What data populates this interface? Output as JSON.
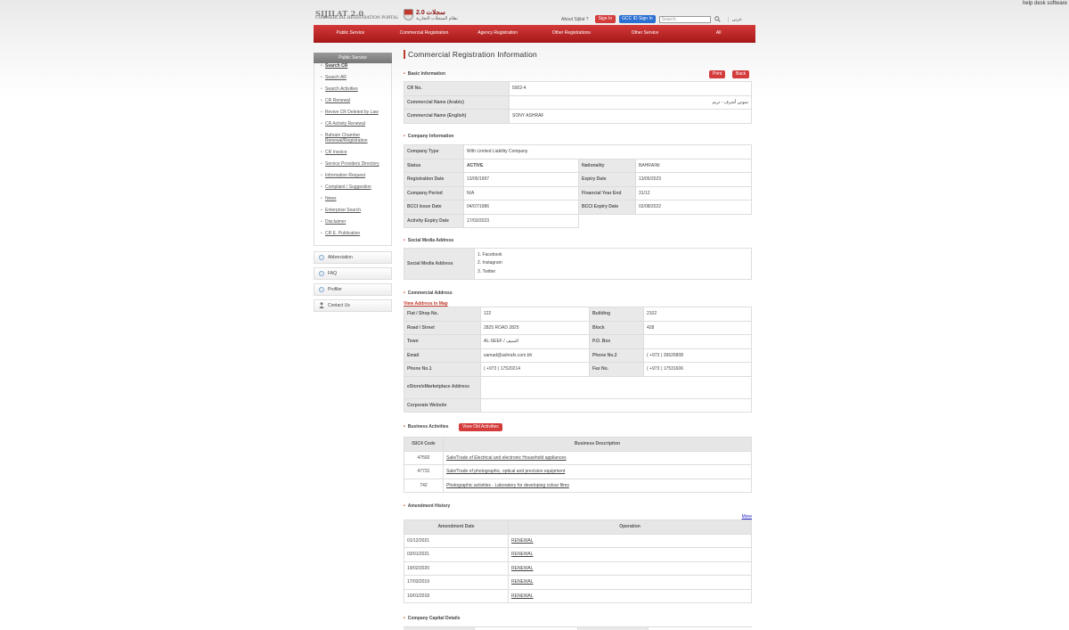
{
  "top_note": "help desk software",
  "header": {
    "logo_en": "SIJILAT 2.0",
    "logo_en_sub": "COMMERCIAL REGISTRATION PORTAL",
    "logo_ar": "سجلات 2.0",
    "logo_ar_sub": "نظام السجلات التجارية",
    "about": "About Sijilat ?",
    "sign_in": "Sign In",
    "gcc_sign_in": "GCC ID Sign In",
    "search_placeholder": "Search..",
    "lang": "عربي"
  },
  "nav": [
    "Public Service",
    "Commercial Registration",
    "Agency Registration",
    "Other Registrations",
    "Other Service",
    "All"
  ],
  "sidebar": {
    "title": "Public Service",
    "items": [
      "Search CR",
      "Search AR",
      "Search Activities",
      "CR Renewal",
      "Revive CR Deleted by Law",
      "CR Activity Renewal",
      "Bahrain Chamber Renewal/Registration",
      "CR Invoice",
      "Service Providers Directory",
      "Information Request",
      "Complaint / Suggestion",
      "News",
      "Enterprise Search",
      "Disclaimer",
      "CR E. Publication"
    ],
    "boxes": [
      {
        "label": "Abbreviation",
        "icon": "info-icon"
      },
      {
        "label": "FAQ",
        "icon": "info-icon"
      },
      {
        "label": "Profiler",
        "icon": "info-icon"
      },
      {
        "label": "Contact Us",
        "icon": "person-icon"
      }
    ]
  },
  "page_title": "Commercial Registration Information",
  "buttons": {
    "print": "Print",
    "back": "Back"
  },
  "basic": {
    "title": "Basic Information",
    "rows": [
      {
        "label": "CR No.",
        "value": "5002-4"
      },
      {
        "label": "Commercial Name (Arabic)",
        "value": "سوني أشرف - تريم"
      },
      {
        "label": "Commercial Name (English)",
        "value": "SONY ASHRAF"
      }
    ]
  },
  "company": {
    "title": "Company Information",
    "company_type_label": "Company Type",
    "company_type": "With Limited Liability Company",
    "status_label": "Status",
    "status": "ACTIVE",
    "nationality_label": "Nationality",
    "nationality": "BAHRAINI",
    "reg_date_label": "Registration Date",
    "reg_date": "13/05/1997",
    "expiry_label": "Expiry Date",
    "expiry": "13/05/2023",
    "period_label": "Company Period",
    "period": "N/A",
    "fy_label": "Financial Year End",
    "fy": "31/12",
    "bcci_issue_label": "BCCI Issue Date",
    "bcci_issue": "04/07/1986",
    "bcci_expiry_label": "BCCI Expiry Date",
    "bcci_expiry": "02/08/2022",
    "activity_expiry_label": "Activity Expiry Date",
    "activity_expiry": "17/03/2023"
  },
  "social": {
    "title": "Social Media Address",
    "label": "Social Media Address",
    "items": [
      "1. Facebook",
      "2. Instagram",
      "3. Twitter"
    ]
  },
  "address": {
    "title": "Commercial Address",
    "map_link": "View Address in Map",
    "flat_label": "Flat / Shop No.",
    "flat": "122",
    "building_label": "Building",
    "building": "2102",
    "road_label": "Road / Street",
    "road": "2825 ROAD 2825",
    "block_label": "Block",
    "block": "428",
    "town_label": "Town",
    "town": "AL-SEEF / السيف",
    "pobox_label": "P.O. Box",
    "pobox": "",
    "email_label": "Email",
    "email": "samad@ashrafs.com.bh",
    "phone2_label": "Phone No.2",
    "phone2": "( +973 ) 39626808",
    "phone1_label": "Phone No.1",
    "phone1": "( +973 ) 17520214",
    "fax_label": "Fax No.",
    "fax": "( +973 ) 17531606",
    "estore_label": "eStore/eMarketplace Address",
    "estore": "",
    "website_label": "Corporate Website",
    "website": ""
  },
  "activities": {
    "title": "Business Activities",
    "old_button": "View Old Activities",
    "col_code": "ISIC4 Code",
    "col_desc": "Business Description",
    "rows": [
      {
        "code": "47592",
        "desc": "Sale/Trade of Electrical and electronic Household appliances"
      },
      {
        "code": "47731",
        "desc": "Sale/Trade of photographic, optical and precision equipment"
      },
      {
        "code": "742",
        "desc": "Photographic activities - Laboratory for developing colour films"
      }
    ]
  },
  "amendments": {
    "title": "Amendment History",
    "more": "More",
    "col_date": "Amendment Date",
    "col_op": "Operation",
    "rows": [
      {
        "date": "01/12/2021",
        "op": "RENEWAL"
      },
      {
        "date": "03/01/2021",
        "op": "RENEWAL"
      },
      {
        "date": "19/02/2020",
        "op": "RENEWAL"
      },
      {
        "date": "17/03/2019",
        "op": "RENEWAL"
      },
      {
        "date": "10/01/2018",
        "op": "RENEWAL"
      }
    ]
  },
  "capital": {
    "title": "Company Capital Details"
  }
}
